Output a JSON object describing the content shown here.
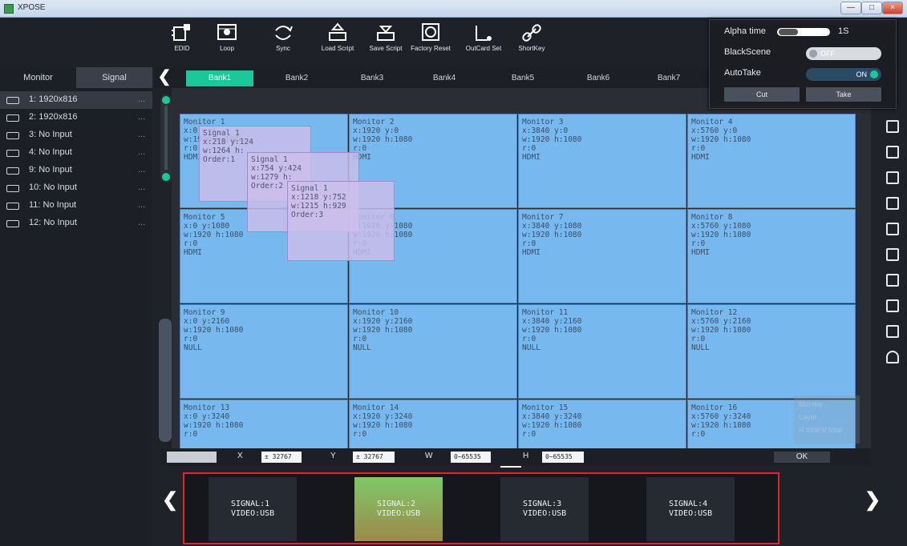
{
  "window": {
    "title": "XPOSE",
    "minimize": "—",
    "maximize": "□",
    "close": "×"
  },
  "toolbar": [
    {
      "name": "edid",
      "label": "EDID"
    },
    {
      "name": "loop",
      "label": "Loop"
    },
    {
      "name": "sync",
      "label": "Sync"
    },
    {
      "name": "load-script",
      "label": "Load Script"
    },
    {
      "name": "save-script",
      "label": "Save Script"
    },
    {
      "name": "factory-reset",
      "label": "Factory Reset"
    },
    {
      "name": "outcard-set",
      "label": "OutCard Set"
    },
    {
      "name": "shortkey",
      "label": "ShortKey"
    }
  ],
  "popup": {
    "alpha_label": "Alpha time",
    "alpha_value": "1S",
    "blackscene_label": "BlackScene",
    "blackscene_state": "OFF",
    "autotake_label": "AutoTake",
    "autotake_state": "ON",
    "cut": "Cut",
    "take": "Take"
  },
  "left_tabs": {
    "monitor": "Monitor",
    "signal": "Signal"
  },
  "signals": [
    {
      "label": "1: 1920x816",
      "dots": "..."
    },
    {
      "label": "2: 1920x816",
      "dots": "..."
    },
    {
      "label": "3: No Input",
      "dots": "..."
    },
    {
      "label": "4: No Input",
      "dots": "..."
    },
    {
      "label": "9: No Input",
      "dots": "..."
    },
    {
      "label": "10: No Input",
      "dots": "..."
    },
    {
      "label": "11: No Input",
      "dots": "..."
    },
    {
      "label": "12: No Input",
      "dots": "..."
    }
  ],
  "banks": [
    "Bank1",
    "Bank2",
    "Bank3",
    "Bank4",
    "Bank5",
    "Bank6",
    "Bank7"
  ],
  "bank_prev": "❮",
  "monitors": [
    {
      "n": "Monitor 1",
      "xy": "x:0  y:0",
      "wh": "w:1920  h:1080",
      "r": "r:0",
      "src": "HDMI"
    },
    {
      "n": "Monitor 2",
      "xy": "x:1920  y:0",
      "wh": "w:1920  h:1080",
      "r": "r:0",
      "src": "HDMI"
    },
    {
      "n": "Monitor 3",
      "xy": "x:3840  y:0",
      "wh": "w:1920  h:1080",
      "r": "r:0",
      "src": "HDMI"
    },
    {
      "n": "Monitor 4",
      "xy": "x:5760  y:0",
      "wh": "w:1920  h:1080",
      "r": "r:0",
      "src": "HDMI"
    },
    {
      "n": "Monitor 5",
      "xy": "x:0  y:1080",
      "wh": "w:1920  h:1080",
      "r": "r:0",
      "src": "HDMI"
    },
    {
      "n": "Monitor 6",
      "xy": "x:1920  y:1080",
      "wh": "w:1920  h:1080",
      "r": "r:0",
      "src": "HDMI"
    },
    {
      "n": "Monitor 7",
      "xy": "x:3840  y:1080",
      "wh": "w:1920  h:1080",
      "r": "r:0",
      "src": "HDMI"
    },
    {
      "n": "Monitor 8",
      "xy": "x:5760  y:1080",
      "wh": "w:1920  h:1080",
      "r": "r:0",
      "src": "HDMI"
    },
    {
      "n": "Monitor 9",
      "xy": "x:0  y:2160",
      "wh": "w:1920  h:1080",
      "r": "r:0",
      "src": "NULL"
    },
    {
      "n": "Monitor 10",
      "xy": "x:1920  y:2160",
      "wh": "w:1920  h:1080",
      "r": "r:0",
      "src": "NULL"
    },
    {
      "n": "Monitor 11",
      "xy": "x:3840  y:2160",
      "wh": "w:1920  h:1080",
      "r": "r:0",
      "src": "NULL"
    },
    {
      "n": "Monitor 12",
      "xy": "x:5760  y:2160",
      "wh": "w:1920  h:1080",
      "r": "r:0",
      "src": "NULL"
    },
    {
      "n": "Monitor 13",
      "xy": "x:0  y:3240",
      "wh": "w:1920  h:1080",
      "r": "r:0",
      "src": ""
    },
    {
      "n": "Monitor 14",
      "xy": "x:1920  y:3240",
      "wh": "w:1920  h:1080",
      "r": "r:0",
      "src": ""
    },
    {
      "n": "Monitor 15",
      "xy": "x:3840  y:3240",
      "wh": "w:1920  h:1080",
      "r": "r:0",
      "src": ""
    },
    {
      "n": "Monitor 16",
      "xy": "x:5760  y:3240",
      "wh": "w:1920  h:1080",
      "r": "r:0",
      "src": ""
    }
  ],
  "layers": [
    {
      "n": "Signal 1",
      "xy": "x:218  y:124",
      "wh": "w:1264  h:",
      "o": "Order:1"
    },
    {
      "n": "Signal 1",
      "xy": "x:754  y:424",
      "wh": "w:1279  h:",
      "o": "Order:2"
    },
    {
      "n": "Signal 1",
      "xy": "x:1218  y:752",
      "wh": "w:1215  h:929",
      "o": "Order:3"
    }
  ],
  "coords": {
    "x_label": "X",
    "x_val": "± 32767",
    "y_label": "Y",
    "y_val": "± 32767",
    "w_label": "W",
    "w_val": "0~65535",
    "h_label": "H",
    "h_val": "0~65535",
    "ok": "OK"
  },
  "legend": {
    "monitor": "Monitor",
    "layer": "Layer",
    "total": "H total V total"
  },
  "thumbs": [
    {
      "l1": "SIGNAL:1",
      "l2": "VIDEO:USB"
    },
    {
      "l1": "SIGNAL:2",
      "l2": "VIDEO:USB"
    },
    {
      "l1": "SIGNAL:3",
      "l2": "VIDEO:USB"
    },
    {
      "l1": "SIGNAL:4",
      "l2": "VIDEO:USB"
    }
  ],
  "nav": {
    "prev": "❮",
    "next": "❯"
  },
  "colors": {
    "accent": "#1bc79b",
    "monitor": "#77b8ee",
    "layer": "#cdbeeb",
    "thumb_border": "#e0282a"
  }
}
